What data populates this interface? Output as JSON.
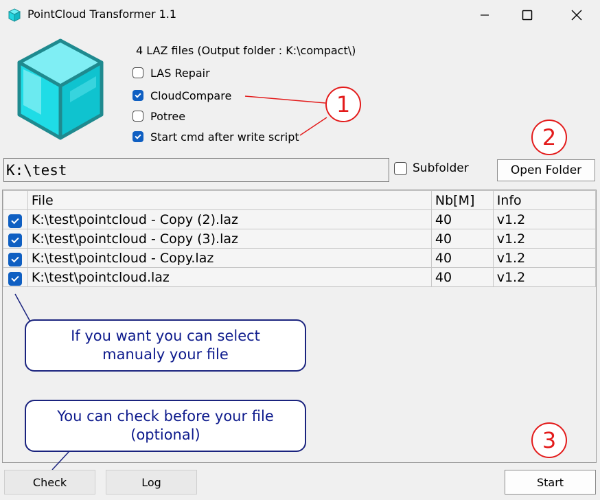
{
  "window": {
    "title": "PointCloud Transformer 1.1"
  },
  "summary": "4 LAZ files (Output folder : K:\\compact\\)",
  "options": [
    {
      "label": "LAS Repair",
      "checked": false
    },
    {
      "label": "CloudCompare",
      "checked": true
    },
    {
      "label": "Potree",
      "checked": false
    },
    {
      "label": "Start cmd after write script",
      "checked": true
    }
  ],
  "folder_path": "K:\\test",
  "subfolder_label": "Subfolder",
  "open_folder_label": "Open Folder",
  "grid": {
    "headers": {
      "file": "File",
      "nb": "Nb[M]",
      "info": "Info"
    },
    "rows": [
      {
        "checked": true,
        "file": "K:\\test\\pointcloud - Copy (2).laz",
        "nb": "40",
        "info": "v1.2"
      },
      {
        "checked": true,
        "file": "K:\\test\\pointcloud - Copy (3).laz",
        "nb": "40",
        "info": "v1.2"
      },
      {
        "checked": true,
        "file": "K:\\test\\pointcloud - Copy.laz",
        "nb": "40",
        "info": "v1.2"
      },
      {
        "checked": true,
        "file": "K:\\test\\pointcloud.laz",
        "nb": "40",
        "info": "v1.2"
      }
    ]
  },
  "callouts": {
    "select": "If you want you can select manualy your file",
    "check": "You can check before your file (optional)"
  },
  "markers": {
    "m1": "1",
    "m2": "2",
    "m3": "3"
  },
  "buttons": {
    "check": "Check",
    "log": "Log",
    "start": "Start"
  },
  "colors": {
    "accent": "#0f5fc2",
    "marker": "#e31b1b",
    "callout": "#1a237e",
    "cube": "#19d3e0"
  }
}
